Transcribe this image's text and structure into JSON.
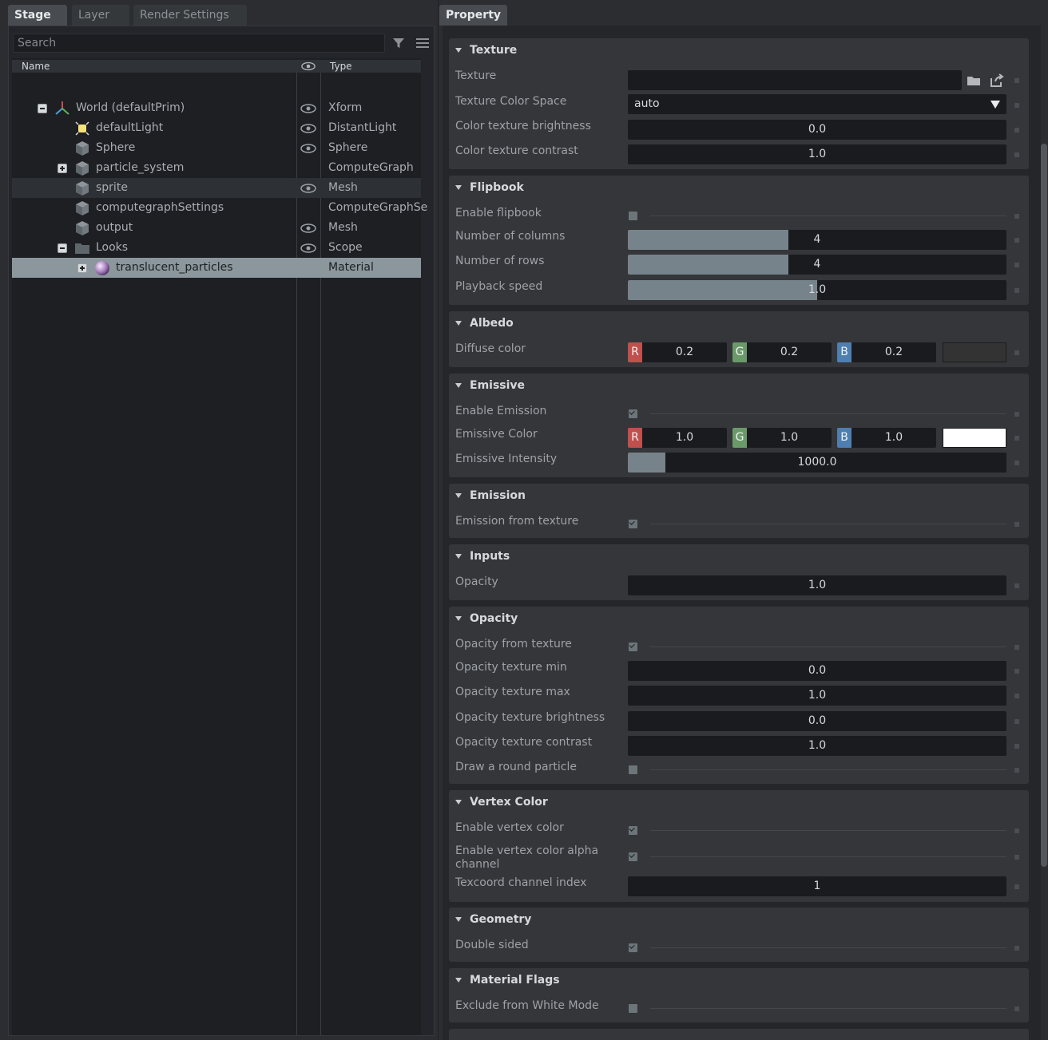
{
  "stage": {
    "tabs": [
      "Stage",
      "Layer",
      "Render Settings"
    ],
    "search_placeholder": "Search",
    "columns": {
      "name": "Name",
      "type": "Type"
    },
    "rows": [
      {
        "name": "World (defaultPrim)",
        "type": "Xform",
        "icon": "xform-axes-icon",
        "expander": "minus",
        "visible": true
      },
      {
        "name": "defaultLight",
        "type": "DistantLight",
        "icon": "light-icon",
        "expander": "",
        "visible": true
      },
      {
        "name": "Sphere",
        "type": "Sphere",
        "icon": "cube-icon",
        "expander": "",
        "visible": true
      },
      {
        "name": "particle_system",
        "type": "ComputeGraph",
        "icon": "cube-icon",
        "expander": "plus",
        "visible": false
      },
      {
        "name": "sprite",
        "type": "Mesh",
        "icon": "cube-icon",
        "expander": "",
        "visible": true
      },
      {
        "name": "computegraphSettings",
        "type": "ComputeGraphSe",
        "icon": "cube-icon",
        "expander": "",
        "visible": false
      },
      {
        "name": "output",
        "type": "Mesh",
        "icon": "cube-icon",
        "expander": "",
        "visible": true
      },
      {
        "name": "Looks",
        "type": "Scope",
        "icon": "folder-icon",
        "expander": "minus",
        "visible": true
      },
      {
        "name": "translucent_particles",
        "type": "Material",
        "icon": "material-sphere-icon",
        "expander": "plus",
        "visible": false
      }
    ]
  },
  "property": {
    "tab": "Property",
    "sections": {
      "texture": {
        "title": "Texture",
        "texture_label": "Texture",
        "texture_value": "",
        "color_space_label": "Texture Color Space",
        "color_space_value": "auto",
        "brightness_label": "Color texture brightness",
        "brightness_value": "0.0",
        "contrast_label": "Color texture contrast",
        "contrast_value": "1.0"
      },
      "flipbook": {
        "title": "Flipbook",
        "enable_label": "Enable flipbook",
        "enable_checked": false,
        "columns_label": "Number of columns",
        "columns_value": "4",
        "columns_fill": 0.425,
        "rows_label": "Number of rows",
        "rows_value": "4",
        "rows_fill": 0.425,
        "speed_label": "Playback speed",
        "speed_value": "1.0",
        "speed_fill": 0.5
      },
      "albedo": {
        "title": "Albedo",
        "diffuse_label": "Diffuse color",
        "r": "0.2",
        "g": "0.2",
        "b": "0.2",
        "swatch_color": "#333333"
      },
      "emissive": {
        "title": "Emissive",
        "enable_label": "Enable Emission",
        "enable_checked": true,
        "color_label": "Emissive Color",
        "r": "1.0",
        "g": "1.0",
        "b": "1.0",
        "swatch_color": "#ffffff",
        "intensity_label": "Emissive Intensity",
        "intensity_value": "1000.0",
        "intensity_fill": 0.1
      },
      "emission": {
        "title": "Emission",
        "from_texture_label": "Emission from texture",
        "from_texture_checked": true
      },
      "inputs": {
        "title": "Inputs",
        "opacity_label": "Opacity",
        "opacity_value": "1.0"
      },
      "opacity": {
        "title": "Opacity",
        "from_texture_label": "Opacity from texture",
        "from_texture_checked": true,
        "min_label": "Opacity texture min",
        "min_value": "0.0",
        "max_label": "Opacity texture max",
        "max_value": "1.0",
        "brightness_label": "Opacity texture brightness",
        "brightness_value": "0.0",
        "contrast_label": "Opacity texture contrast",
        "contrast_value": "1.0",
        "round_label": "Draw a round particle",
        "round_checked": false
      },
      "vertex_color": {
        "title": "Vertex Color",
        "enable_label": "Enable vertex color",
        "enable_checked": true,
        "alpha_label": "Enable vertex color alpha channel",
        "alpha_checked": true,
        "texcoord_label": "Texcoord channel index",
        "texcoord_value": "1"
      },
      "geometry": {
        "title": "Geometry",
        "double_sided_label": "Double sided",
        "double_sided_checked": true
      },
      "material_flags": {
        "title": "Material Flags",
        "exclude_label": "Exclude from White Mode",
        "exclude_checked": false
      }
    }
  },
  "colors": {
    "red_channel": "#c0504d",
    "green_channel": "#6a9a6a",
    "blue_channel": "#4f7fb0",
    "selection": "#8b979c",
    "slider_fill": "#77838a"
  }
}
